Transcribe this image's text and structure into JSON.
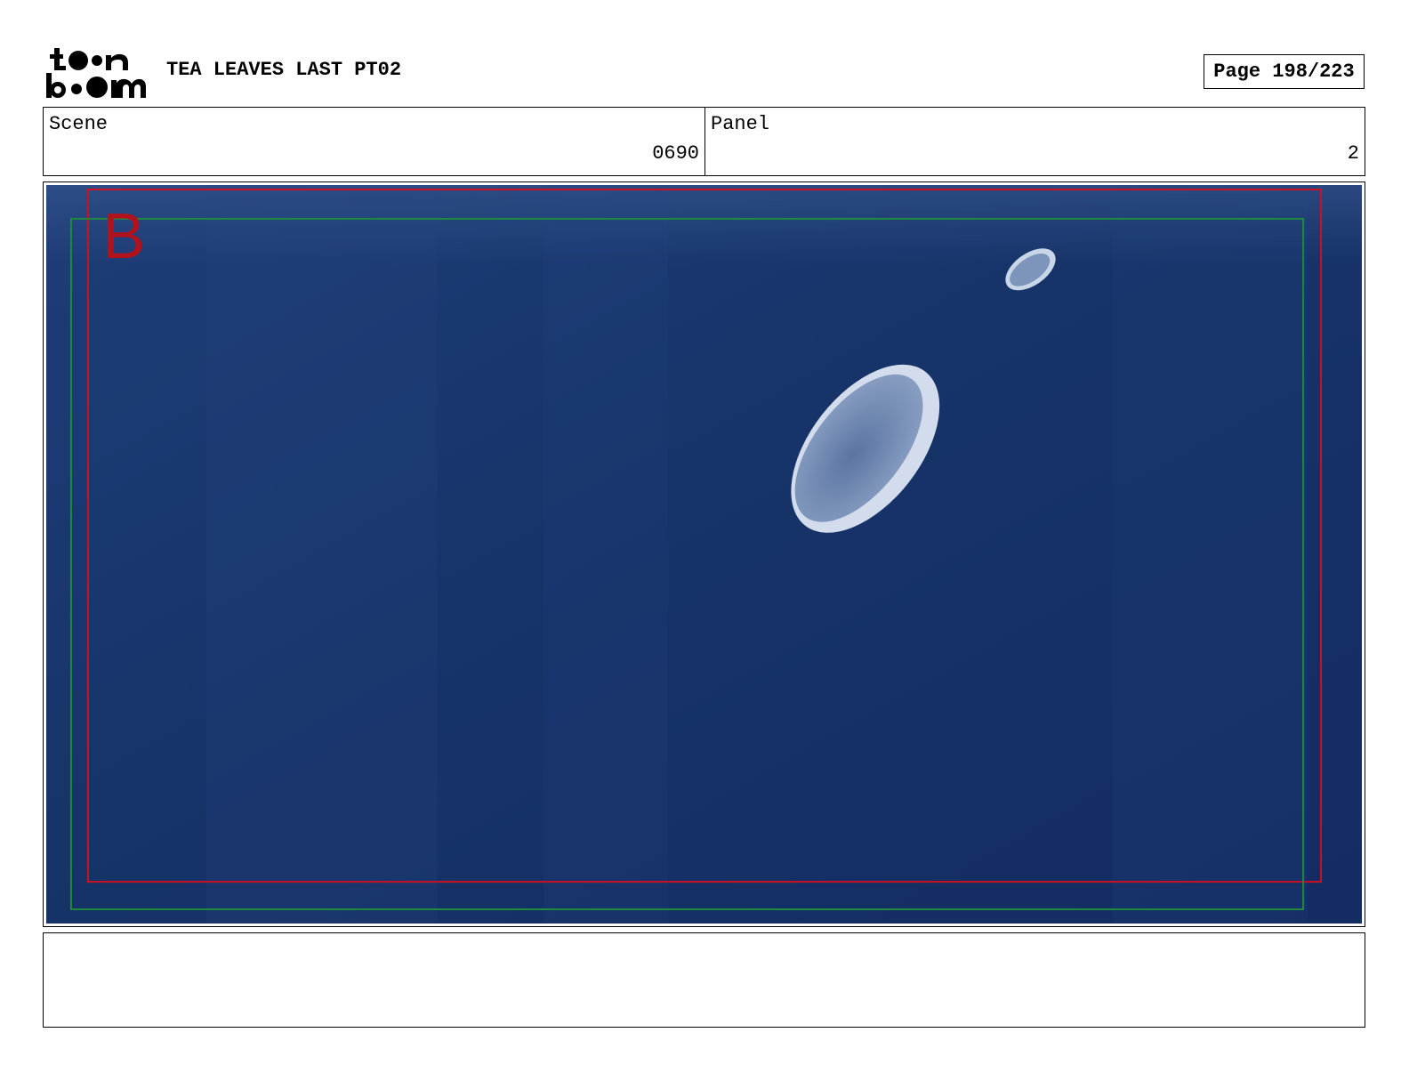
{
  "header": {
    "logo_line1": "toon",
    "logo_line2": "boom",
    "title": "TEA LEAVES LAST PT02",
    "page_label": "Page 198/223"
  },
  "info": {
    "scene_label": "Scene",
    "scene_value": "0690",
    "panel_label": "Panel",
    "panel_value": "2"
  },
  "frame": {
    "letter": "B",
    "background_color": "#1b3a74",
    "safe_frame_color": "#cc1122",
    "title_safe_color": "#1e8a3c",
    "bubble_color": "#c9d6e8"
  },
  "notes": {
    "text": ""
  }
}
